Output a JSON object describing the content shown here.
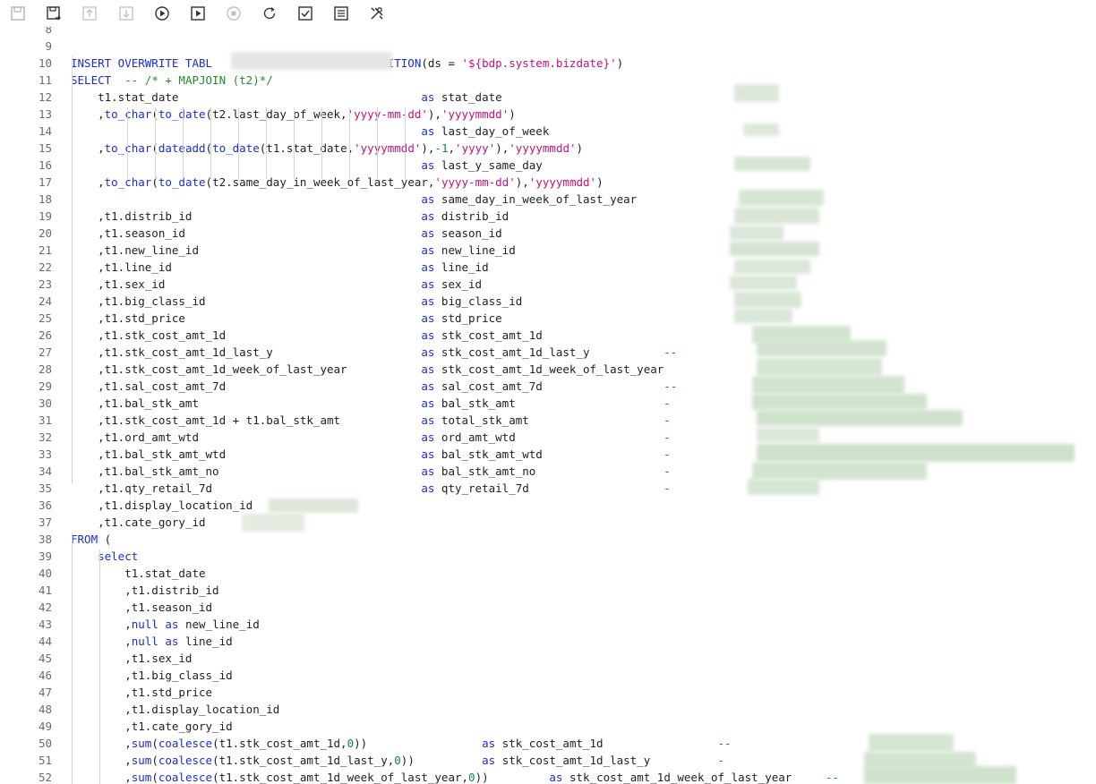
{
  "toolbar": {
    "icons": [
      "save-icon",
      "save-as-icon",
      "upload-icon",
      "download-icon",
      "run-icon",
      "run-advanced-icon",
      "stop-icon",
      "refresh-icon",
      "check-icon",
      "format-icon",
      "tools-icon"
    ]
  },
  "colors": {
    "keyword": "#1a2dd6",
    "string": "#c4127a",
    "number": "#0a8a3a",
    "comment": "#238b2f",
    "text": "#1f1f1f",
    "line_number": "#6c6c6c"
  },
  "editor": {
    "lines": [
      {
        "n": "8",
        "tokens": []
      },
      {
        "n": "9",
        "tokens": []
      },
      {
        "n": "10",
        "tokens": [
          {
            "t": "INSERT OVERWRITE TABL",
            "c": "kw"
          },
          {
            "t": "                      ",
            "c": ""
          },
          {
            "t": "PARTITION",
            "c": "kw"
          },
          {
            "t": "(ds = ",
            "c": ""
          },
          {
            "t": "'${bdp.system.bizdate}'",
            "c": "str"
          },
          {
            "t": ")",
            "c": ""
          }
        ]
      },
      {
        "n": "11",
        "tokens": [
          {
            "t": "SELECT",
            "c": "kw"
          },
          {
            "t": "  ",
            "c": ""
          },
          {
            "t": "-- /* + MAPJOIN (t2)*/",
            "c": "cm"
          }
        ]
      },
      {
        "n": "12",
        "tokens": [
          {
            "t": "    t1.stat_date                                    ",
            "c": ""
          },
          {
            "t": "as",
            "c": "kw"
          },
          {
            "t": " stat_date",
            "c": ""
          }
        ]
      },
      {
        "n": "13",
        "tokens": [
          {
            "t": "    ,",
            "c": ""
          },
          {
            "t": "to_char",
            "c": "fn"
          },
          {
            "t": "(",
            "c": ""
          },
          {
            "t": "to_date",
            "c": "fn"
          },
          {
            "t": "(t2.last_day_of_week,",
            "c": ""
          },
          {
            "t": "'yyyy-mm-dd'",
            "c": "str"
          },
          {
            "t": "),",
            "c": ""
          },
          {
            "t": "'yyyymmdd'",
            "c": "str"
          },
          {
            "t": ")",
            "c": ""
          }
        ]
      },
      {
        "n": "14",
        "tokens": [
          {
            "t": "                                                    ",
            "c": ""
          },
          {
            "t": "as",
            "c": "kw"
          },
          {
            "t": " last_day_of_week",
            "c": ""
          }
        ]
      },
      {
        "n": "15",
        "tokens": [
          {
            "t": "    ,",
            "c": ""
          },
          {
            "t": "to_char",
            "c": "fn"
          },
          {
            "t": "(",
            "c": ""
          },
          {
            "t": "dateadd",
            "c": "fn"
          },
          {
            "t": "(",
            "c": ""
          },
          {
            "t": "to_date",
            "c": "fn"
          },
          {
            "t": "(t1.stat_date,",
            "c": ""
          },
          {
            "t": "'yyyymmdd'",
            "c": "str"
          },
          {
            "t": "),",
            "c": ""
          },
          {
            "t": "-1",
            "c": "num"
          },
          {
            "t": ",",
            "c": ""
          },
          {
            "t": "'yyyy'",
            "c": "str"
          },
          {
            "t": "),",
            "c": ""
          },
          {
            "t": "'yyyymmdd'",
            "c": "str"
          },
          {
            "t": ")",
            "c": ""
          }
        ]
      },
      {
        "n": "16",
        "tokens": [
          {
            "t": "                                                    ",
            "c": ""
          },
          {
            "t": "as",
            "c": "kw"
          },
          {
            "t": " last_y_same_day",
            "c": ""
          }
        ]
      },
      {
        "n": "17",
        "tokens": [
          {
            "t": "    ,",
            "c": ""
          },
          {
            "t": "to_char",
            "c": "fn"
          },
          {
            "t": "(",
            "c": ""
          },
          {
            "t": "to_date",
            "c": "fn"
          },
          {
            "t": "(t2.same_day_in_week_of_last_year,",
            "c": ""
          },
          {
            "t": "'yyyy-mm-dd'",
            "c": "str"
          },
          {
            "t": "),",
            "c": ""
          },
          {
            "t": "'yyyymmdd'",
            "c": "str"
          },
          {
            "t": ")",
            "c": ""
          }
        ]
      },
      {
        "n": "18",
        "tokens": [
          {
            "t": "                                                    ",
            "c": ""
          },
          {
            "t": "as",
            "c": "kw"
          },
          {
            "t": " same_day_in_week_of_last_year",
            "c": ""
          }
        ]
      },
      {
        "n": "19",
        "tokens": [
          {
            "t": "    ,t1.distrib_id                                  ",
            "c": ""
          },
          {
            "t": "as",
            "c": "kw"
          },
          {
            "t": " distrib_id",
            "c": ""
          }
        ]
      },
      {
        "n": "20",
        "tokens": [
          {
            "t": "    ,t1.season_id                                   ",
            "c": ""
          },
          {
            "t": "as",
            "c": "kw"
          },
          {
            "t": " season_id",
            "c": ""
          }
        ]
      },
      {
        "n": "21",
        "tokens": [
          {
            "t": "    ,t1.new_line_id                                 ",
            "c": ""
          },
          {
            "t": "as",
            "c": "kw"
          },
          {
            "t": " new_line_id",
            "c": ""
          }
        ]
      },
      {
        "n": "22",
        "tokens": [
          {
            "t": "    ,t1.line_id                                     ",
            "c": ""
          },
          {
            "t": "as",
            "c": "kw"
          },
          {
            "t": " line_id",
            "c": ""
          }
        ]
      },
      {
        "n": "23",
        "tokens": [
          {
            "t": "    ,t1.sex_id                                      ",
            "c": ""
          },
          {
            "t": "as",
            "c": "kw"
          },
          {
            "t": " sex_id",
            "c": ""
          }
        ]
      },
      {
        "n": "24",
        "tokens": [
          {
            "t": "    ,t1.big_class_id                                ",
            "c": ""
          },
          {
            "t": "as",
            "c": "kw"
          },
          {
            "t": " big_class_id",
            "c": ""
          }
        ]
      },
      {
        "n": "25",
        "tokens": [
          {
            "t": "    ,t1.std_price                                   ",
            "c": ""
          },
          {
            "t": "as",
            "c": "kw"
          },
          {
            "t": " std_price",
            "c": ""
          }
        ]
      },
      {
        "n": "26",
        "tokens": [
          {
            "t": "    ,t1.stk_cost_amt_1d                             ",
            "c": ""
          },
          {
            "t": "as",
            "c": "kw"
          },
          {
            "t": " stk_cost_amt_1d",
            "c": ""
          }
        ]
      },
      {
        "n": "27",
        "tokens": [
          {
            "t": "    ,t1.stk_cost_amt_1d_last_y                      ",
            "c": ""
          },
          {
            "t": "as",
            "c": "kw"
          },
          {
            "t": " stk_cost_amt_1d_last_y",
            "c": ""
          },
          {
            "t": "           --",
            "c": "cm"
          }
        ]
      },
      {
        "n": "28",
        "tokens": [
          {
            "t": "    ,t1.stk_cost_amt_1d_week_of_last_year           ",
            "c": ""
          },
          {
            "t": "as",
            "c": "kw"
          },
          {
            "t": " stk_cost_amt_1d_week_of_last_year",
            "c": ""
          }
        ]
      },
      {
        "n": "29",
        "tokens": [
          {
            "t": "    ,t1.sal_cost_amt_7d                             ",
            "c": ""
          },
          {
            "t": "as",
            "c": "kw"
          },
          {
            "t": " sal_cost_amt_7d",
            "c": ""
          },
          {
            "t": "                  --",
            "c": "cm"
          }
        ]
      },
      {
        "n": "30",
        "tokens": [
          {
            "t": "    ,t1.bal_stk_amt                                 ",
            "c": ""
          },
          {
            "t": "as",
            "c": "kw"
          },
          {
            "t": " bal_stk_amt",
            "c": ""
          },
          {
            "t": "                      -",
            "c": "cm"
          }
        ]
      },
      {
        "n": "31",
        "tokens": [
          {
            "t": "    ,t1.stk_cost_amt_1d + t1.bal_stk_amt            ",
            "c": ""
          },
          {
            "t": "as",
            "c": "kw"
          },
          {
            "t": " total_stk_amt",
            "c": ""
          },
          {
            "t": "                    -",
            "c": "cm"
          }
        ]
      },
      {
        "n": "32",
        "tokens": [
          {
            "t": "    ,t1.ord_amt_wtd                                 ",
            "c": ""
          },
          {
            "t": "as",
            "c": "kw"
          },
          {
            "t": " ord_amt_wtd",
            "c": ""
          },
          {
            "t": "                      -",
            "c": "cm"
          }
        ]
      },
      {
        "n": "33",
        "tokens": [
          {
            "t": "    ,t1.bal_stk_amt_wtd                             ",
            "c": ""
          },
          {
            "t": "as",
            "c": "kw"
          },
          {
            "t": " bal_stk_amt_wtd",
            "c": ""
          },
          {
            "t": "                  -",
            "c": "cm"
          }
        ]
      },
      {
        "n": "34",
        "tokens": [
          {
            "t": "    ,t1.bal_stk_amt_no                              ",
            "c": ""
          },
          {
            "t": "as",
            "c": "kw"
          },
          {
            "t": " bal_stk_amt_no",
            "c": ""
          },
          {
            "t": "                   -",
            "c": "cm"
          }
        ]
      },
      {
        "n": "35",
        "tokens": [
          {
            "t": "    ,t1.qty_retail_7d                               ",
            "c": ""
          },
          {
            "t": "as",
            "c": "kw"
          },
          {
            "t": " qty_retail_7d",
            "c": ""
          },
          {
            "t": "                    -",
            "c": "cm"
          }
        ]
      },
      {
        "n": "36",
        "tokens": [
          {
            "t": "    ,t1.display_location_id",
            "c": ""
          }
        ]
      },
      {
        "n": "37",
        "tokens": [
          {
            "t": "    ,t1.cate_gory_id",
            "c": ""
          }
        ]
      },
      {
        "n": "38",
        "tokens": [
          {
            "t": "FROM",
            "c": "kw"
          },
          {
            "t": " (",
            "c": ""
          }
        ]
      },
      {
        "n": "39",
        "tokens": [
          {
            "t": "    ",
            "c": ""
          },
          {
            "t": "select",
            "c": "kw"
          }
        ]
      },
      {
        "n": "40",
        "tokens": [
          {
            "t": "        t1.stat_date",
            "c": ""
          }
        ]
      },
      {
        "n": "41",
        "tokens": [
          {
            "t": "        ,t1.distrib_id",
            "c": ""
          }
        ]
      },
      {
        "n": "42",
        "tokens": [
          {
            "t": "        ,t1.season_id",
            "c": ""
          }
        ]
      },
      {
        "n": "43",
        "tokens": [
          {
            "t": "        ,",
            "c": ""
          },
          {
            "t": "null",
            "c": "kw"
          },
          {
            "t": " ",
            "c": ""
          },
          {
            "t": "as",
            "c": "kw"
          },
          {
            "t": " new_line_id",
            "c": ""
          }
        ]
      },
      {
        "n": "44",
        "tokens": [
          {
            "t": "        ,",
            "c": ""
          },
          {
            "t": "null",
            "c": "kw"
          },
          {
            "t": " ",
            "c": ""
          },
          {
            "t": "as",
            "c": "kw"
          },
          {
            "t": " line_id",
            "c": ""
          }
        ]
      },
      {
        "n": "45",
        "tokens": [
          {
            "t": "        ,t1.sex_id",
            "c": ""
          }
        ]
      },
      {
        "n": "46",
        "tokens": [
          {
            "t": "        ,t1.big_class_id",
            "c": ""
          }
        ]
      },
      {
        "n": "47",
        "tokens": [
          {
            "t": "        ,t1.std_price",
            "c": ""
          }
        ]
      },
      {
        "n": "48",
        "tokens": [
          {
            "t": "        ,t1.display_location_id",
            "c": ""
          }
        ]
      },
      {
        "n": "49",
        "tokens": [
          {
            "t": "        ,t1.cate_gory_id",
            "c": ""
          }
        ]
      },
      {
        "n": "50",
        "tokens": [
          {
            "t": "        ,",
            "c": ""
          },
          {
            "t": "sum",
            "c": "fn"
          },
          {
            "t": "(",
            "c": ""
          },
          {
            "t": "coalesce",
            "c": "fn"
          },
          {
            "t": "(t1.stk_cost_amt_1d,",
            "c": ""
          },
          {
            "t": "0",
            "c": "num"
          },
          {
            "t": "))                 ",
            "c": ""
          },
          {
            "t": "as",
            "c": "kw"
          },
          {
            "t": " stk_cost_amt_1d",
            "c": ""
          },
          {
            "t": "                 --",
            "c": "cm"
          }
        ]
      },
      {
        "n": "51",
        "tokens": [
          {
            "t": "        ,",
            "c": ""
          },
          {
            "t": "sum",
            "c": "fn"
          },
          {
            "t": "(",
            "c": ""
          },
          {
            "t": "coalesce",
            "c": "fn"
          },
          {
            "t": "(t1.stk_cost_amt_1d_last_y,",
            "c": ""
          },
          {
            "t": "0",
            "c": "num"
          },
          {
            "t": "))          ",
            "c": ""
          },
          {
            "t": "as",
            "c": "kw"
          },
          {
            "t": " stk_cost_amt_1d_last_y",
            "c": ""
          },
          {
            "t": "          -",
            "c": "cm"
          }
        ]
      },
      {
        "n": "52",
        "tokens": [
          {
            "t": "        ,",
            "c": ""
          },
          {
            "t": "sum",
            "c": "fn"
          },
          {
            "t": "(",
            "c": ""
          },
          {
            "t": "coalesce",
            "c": "fn"
          },
          {
            "t": "(t1.stk_cost_amt_1d_week_of_last_year,",
            "c": ""
          },
          {
            "t": "0",
            "c": "num"
          },
          {
            "t": "))         ",
            "c": ""
          },
          {
            "t": "as",
            "c": "kw"
          },
          {
            "t": " stk_cost_amt_1d_week_of_last_year",
            "c": ""
          },
          {
            "t": "     --",
            "c": "cm"
          }
        ]
      }
    ]
  }
}
